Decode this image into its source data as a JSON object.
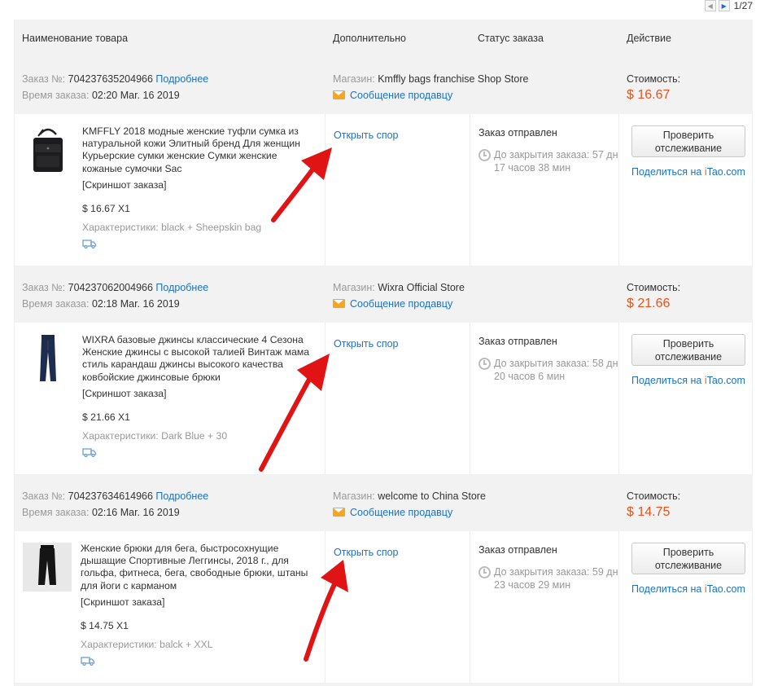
{
  "pager": {
    "prev_icon": "chevron-left-icon",
    "next_icon": "chevron-right-icon",
    "text": "1/27"
  },
  "columns": {
    "product": "Наименование товара",
    "extra": "Дополнительно",
    "status": "Статус заказа",
    "action": "Действие"
  },
  "labels": {
    "order_no": "Заказ №:",
    "details": "Подробнее",
    "order_time": "Время заказа:",
    "store": "Магазин:",
    "message_seller": "Сообщение продавцу",
    "cost": "Стоимость:",
    "open_dispute": "Открыть спор",
    "screenshot": "[Скриншот заказа]",
    "chars": "Характеристики:",
    "track_line1": "Проверить",
    "track_line2": "отслеживание",
    "share_prefix": "Поделиться на ",
    "share_i": "i",
    "share_rest": "Tao.com"
  },
  "orders": [
    {
      "number": "704237635204966",
      "time": "02:20 Mar. 16 2019",
      "store": "Kmffly bags franchise Shop Store",
      "cost": "$ 16.67",
      "title": "KMFFLY 2018 модные женские туфли сумка из натуральной кожи Элитный бренд Для женщин Курьерские сумки женские Сумки женские кожаные сумочки Sac",
      "qty": "$ 16.67 X1",
      "chars": "black + Sheepskin bag",
      "status": "Заказ отправлен",
      "timer": "До закрытия заказа: 57 дн 17 часов 38 мин"
    },
    {
      "number": "704237062004966",
      "time": "02:18 Mar. 16 2019",
      "store": "Wixra Official Store",
      "cost": "$ 21.66",
      "title": "WIXRA базовые джинсы классические 4 Сезона Женские джинсы с высокой талией Винтаж мама стиль карандаш джинсы высокого качества ковбойские джинсовые брюки",
      "qty": "$ 21.66 X1",
      "chars": "Dark Blue + 30",
      "status": "Заказ отправлен",
      "timer": "До закрытия заказа: 58 дн 20 часов 6 мин"
    },
    {
      "number": "704237634614966",
      "time": "02:16 Mar. 16 2019",
      "store": "welcome to China Store",
      "cost": "$ 14.75",
      "title": "Женские брюки для бега, быстросохнущие дышащие Спортивные Леггинсы, 2018 г., для гольфа, фитнеса, бега, свободные брюки, штаны для йоги с карманом",
      "qty": "$ 14.75 X1",
      "chars": "balck + XXL",
      "status": "Заказ отправлен",
      "timer": "До закрытия заказа: 59 дн 23 часов 29 мин"
    }
  ],
  "colors": {
    "link": "#1a73c7",
    "price": "#e8531c",
    "arrow": "#e01414",
    "header_bg": "#f2f2f2"
  }
}
